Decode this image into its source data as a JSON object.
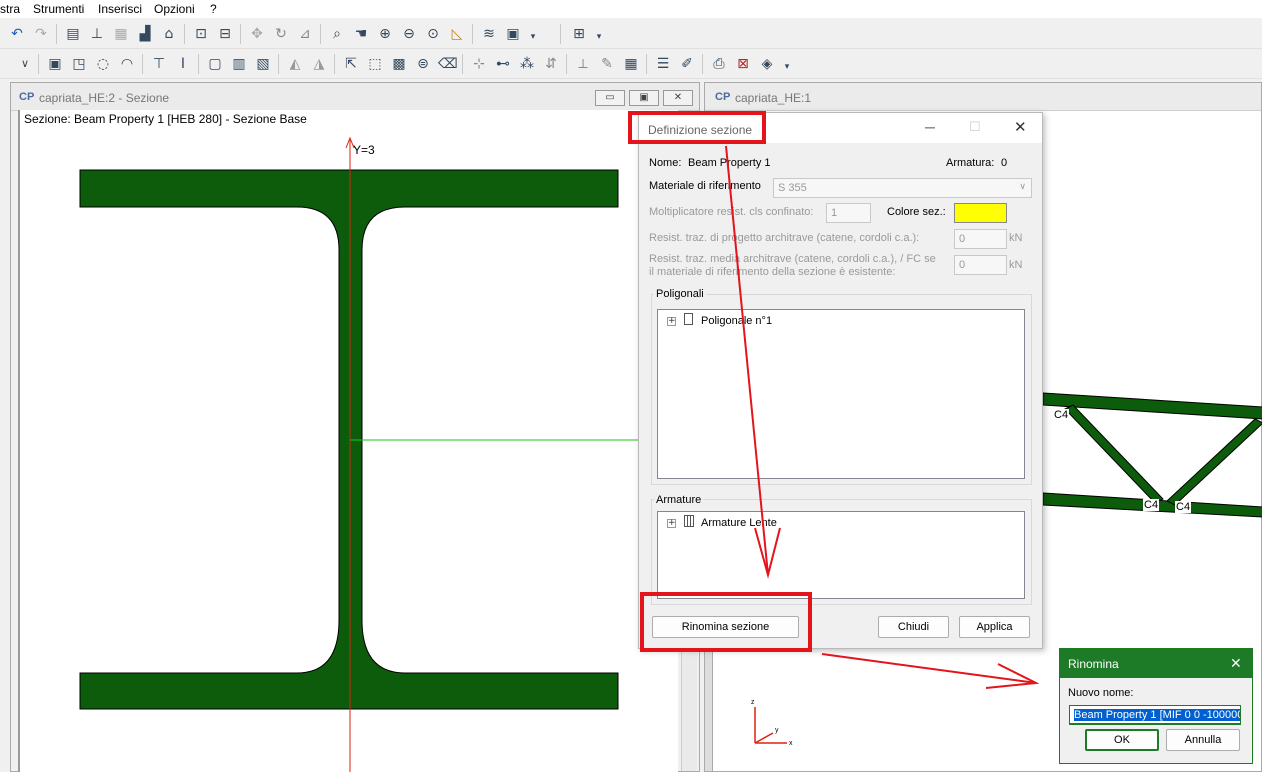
{
  "menu": [
    "stra",
    "Strumenti",
    "Inserisci",
    "Opzioni",
    "?"
  ],
  "left_window": {
    "title": "capriata_HE:2 - Sezione",
    "section_caption": "Sezione: Beam Property 1 [HEB 280] - Sezione Base",
    "axis_label": "Y=3"
  },
  "right_window": {
    "title": "capriata_HE:1",
    "node_labels": [
      "C4",
      "C4",
      "C4"
    ],
    "axes": {
      "z": "z",
      "y": "y",
      "x": "x"
    }
  },
  "dialog": {
    "title": "Definizione sezione",
    "name_label": "Nome:",
    "name_value": "Beam Property 1",
    "armatura_label": "Armatura:",
    "armatura_value": "0",
    "material_label": "Materiale di riferimento",
    "material_value": "S 355",
    "mult_label": "Moltiplicatore resist. cls confinato:",
    "mult_value": "1",
    "color_label": "Colore sez.:",
    "color_value": "#ffff00",
    "resist1_label": "Resist. traz. di progetto architrave (catene, cordoli c.a.):",
    "resist1_value": "0",
    "resist1_unit": "kN",
    "resist2_label_line1": "Resist. traz. media architrave (catene, cordoli c.a.), / FC se",
    "resist2_label_line2": "il materiale di riferimento della sezione è esistente:",
    "resist2_value": "0",
    "resist2_unit": "kN",
    "poligonali_title": "Poligonali",
    "poligonali_item": "Poligonale n°1",
    "armature_title": "Armature",
    "armature_item": "Armature Lente",
    "rename_button": "Rinomina sezione",
    "close_button": "Chiudi",
    "apply_button": "Applica"
  },
  "rename_dialog": {
    "title": "Rinomina",
    "label": "Nuovo nome:",
    "value": "Beam Property 1 [MIF 0 0 -100000",
    "ok": "OK",
    "cancel": "Annulla"
  },
  "colors": {
    "section_fill": "#0c5c0c",
    "highlight": "#e3141c",
    "rename_title_bg": "#1d7a26"
  }
}
